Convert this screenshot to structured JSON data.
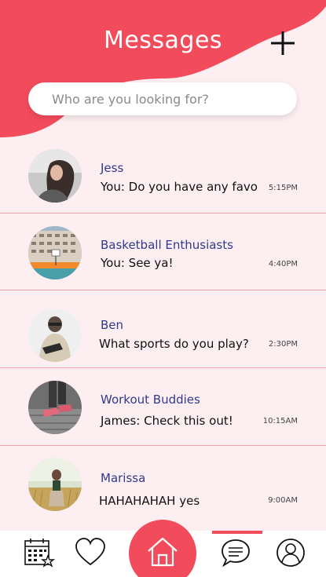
{
  "header": {
    "title": "Messages",
    "add_icon": "plus-icon"
  },
  "search": {
    "placeholder": "Who are you looking for?"
  },
  "conversations": [
    {
      "name": "Jess",
      "preview": "You: Do you have any favo",
      "time": "5:15PM",
      "avatar": "woman-profile-photo"
    },
    {
      "name": "Basketball Enthusiasts",
      "preview": "You: See ya!",
      "time": "4:40PM",
      "avatar": "basketball-court-photo"
    },
    {
      "name": "Ben",
      "preview": "What sports do you play?",
      "time": "2:30PM",
      "avatar": "man-profile-photo"
    },
    {
      "name": "Workout Buddies",
      "preview": "James: Check this out!",
      "time": "10:15AM",
      "avatar": "running-shoes-photo"
    },
    {
      "name": "Marissa",
      "preview": "HAHAHAHAH yes",
      "time": "9:00AM",
      "avatar": "woman-in-field-photo"
    }
  ],
  "nav": {
    "items": [
      "calendar-icon",
      "heart-icon",
      "home-icon",
      "chat-icon",
      "profile-icon"
    ],
    "active": "chat-icon"
  },
  "colors": {
    "accent": "#f24b5c",
    "background": "#fdeff1",
    "name_text": "#2f3a8c",
    "divider": "#f1a3ad"
  }
}
